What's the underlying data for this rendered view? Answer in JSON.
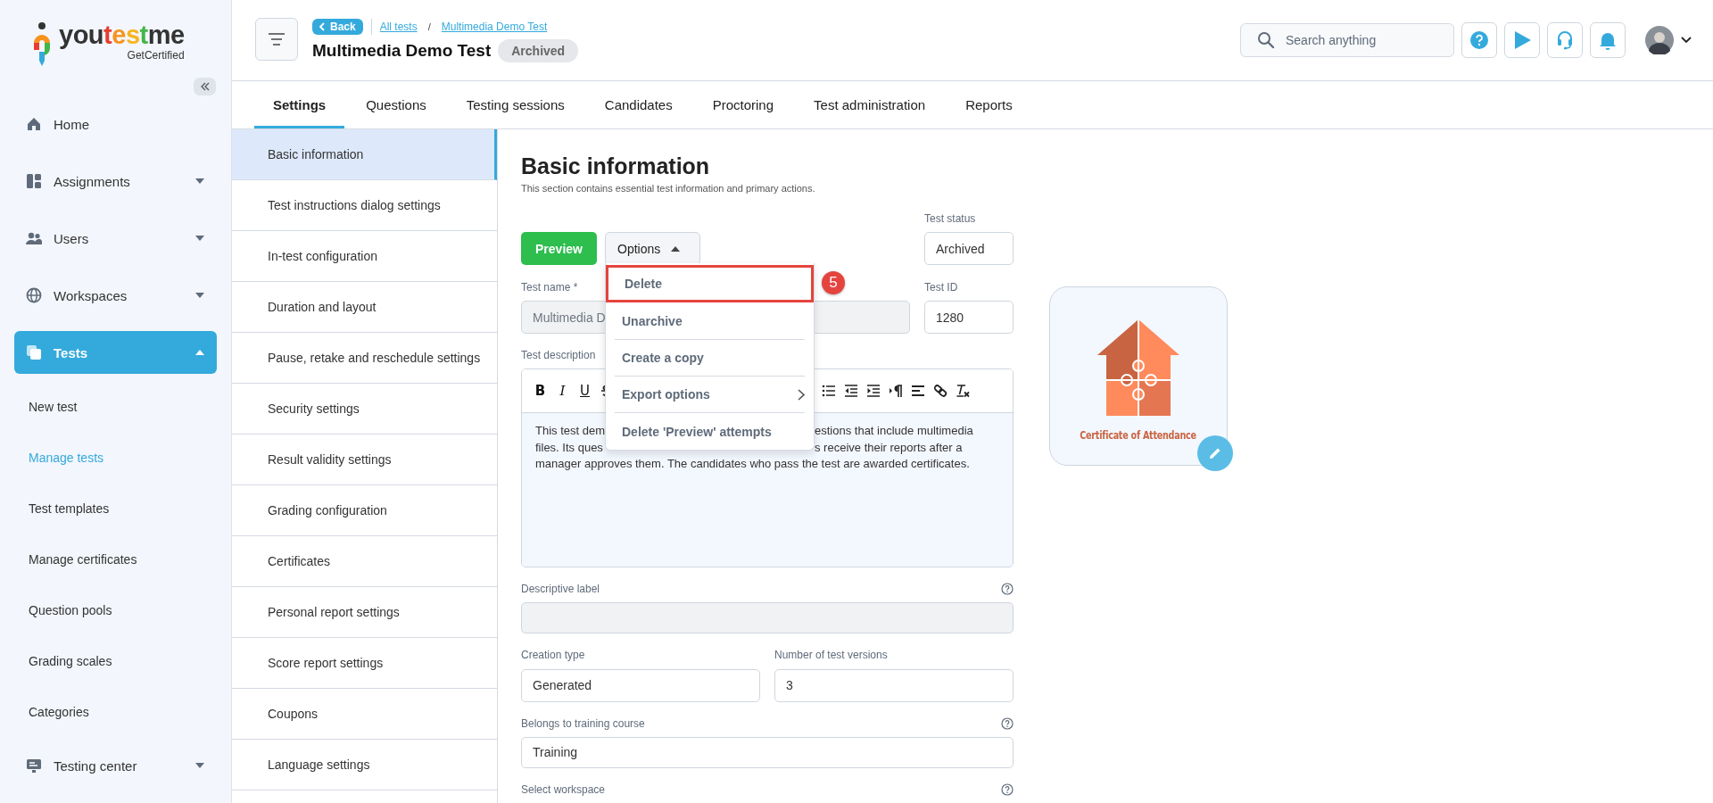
{
  "logo": {
    "text": "youtestme",
    "tagline": "GetCertified"
  },
  "sidebar": {
    "items": [
      {
        "label": "Home",
        "selected": false
      },
      {
        "label": "Assignments",
        "expanded": false,
        "selected": false
      },
      {
        "label": "Users",
        "expanded": false,
        "selected": false
      },
      {
        "label": "Workspaces",
        "expanded": false,
        "selected": false
      },
      {
        "label": "Tests",
        "expanded": true,
        "selected": true,
        "children": [
          {
            "label": "New test",
            "selected": false
          },
          {
            "label": "Manage tests",
            "selected": true
          },
          {
            "label": "Test templates",
            "selected": false
          },
          {
            "label": "Manage certificates",
            "selected": false
          },
          {
            "label": "Question pools",
            "selected": false
          },
          {
            "label": "Grading scales",
            "selected": false
          },
          {
            "label": "Categories",
            "selected": false
          }
        ]
      },
      {
        "label": "Testing center",
        "expanded": false,
        "selected": false
      }
    ]
  },
  "header": {
    "back": "Back",
    "breadcrumb": [
      "All tests",
      "Multimedia Demo Test"
    ],
    "separator": "/",
    "title": "Multimedia Demo Test",
    "status_badge": "Archived"
  },
  "search": {
    "placeholder": "Search anything"
  },
  "tabs": [
    {
      "label": "Settings",
      "selected": true
    },
    {
      "label": "Questions",
      "selected": false
    },
    {
      "label": "Testing sessions",
      "selected": false
    },
    {
      "label": "Candidates",
      "selected": false
    },
    {
      "label": "Proctoring",
      "selected": false
    },
    {
      "label": "Test administration",
      "selected": false
    },
    {
      "label": "Reports",
      "selected": false
    }
  ],
  "settings_menu": [
    {
      "label": "Basic information",
      "selected": true
    },
    {
      "label": "Test instructions dialog settings",
      "selected": false
    },
    {
      "label": "In-test configuration",
      "selected": false
    },
    {
      "label": "Duration and layout",
      "selected": false
    },
    {
      "label": "Pause, retake and reschedule settings",
      "selected": false
    },
    {
      "label": "Security settings",
      "selected": false
    },
    {
      "label": "Result validity settings",
      "selected": false
    },
    {
      "label": "Grading configuration",
      "selected": false
    },
    {
      "label": "Certificates",
      "selected": false
    },
    {
      "label": "Personal report settings",
      "selected": false
    },
    {
      "label": "Score report settings",
      "selected": false
    },
    {
      "label": "Coupons",
      "selected": false
    },
    {
      "label": "Language settings",
      "selected": false
    }
  ],
  "section": {
    "title": "Basic information",
    "subtitle": "This section contains essential test information and primary actions."
  },
  "preview_button": "Preview",
  "options_button": {
    "label": "Options",
    "expanded": true
  },
  "options_menu": {
    "step_marker": "5",
    "items": [
      {
        "label": "Delete",
        "highlighted": true
      },
      {
        "label": "Unarchive",
        "highlighted": false
      },
      {
        "label": "Create a copy",
        "highlighted": false
      },
      {
        "label": "Export options",
        "highlighted": false,
        "submenu": true
      },
      {
        "label": "Delete 'Preview' attempts",
        "highlighted": false
      }
    ]
  },
  "test_status": {
    "label": "Test status",
    "value": "Archived"
  },
  "test_name": {
    "label": "Test name *",
    "disabled": true,
    "value": "Multimedia D"
  },
  "test_id": {
    "label": "Test ID",
    "value": "1280"
  },
  "description": {
    "label": "Test description",
    "toolbar": [
      "B",
      "I",
      "U"
    ],
    "lines": [
      {
        "left": "This test dem",
        "right": "estions that include multimedia"
      },
      {
        "left": "files. Its ques",
        "right": "s receive their reports after a"
      },
      {
        "left": "manager approves them. The candidates who pass the test are awarded certificates."
      }
    ]
  },
  "descriptive_label": {
    "label": "Descriptive label",
    "help": true,
    "disabled": true
  },
  "creation_type": {
    "label": "Creation type",
    "value": "Generated"
  },
  "test_versions": {
    "label": "Number of test versions",
    "value": "3"
  },
  "training_course": {
    "label": "Belongs to training course",
    "value": "Training",
    "help": true
  },
  "select_workspace": {
    "label": "Select workspace",
    "help": true
  },
  "certificate": {
    "caption": "Certificate of Attendance"
  }
}
